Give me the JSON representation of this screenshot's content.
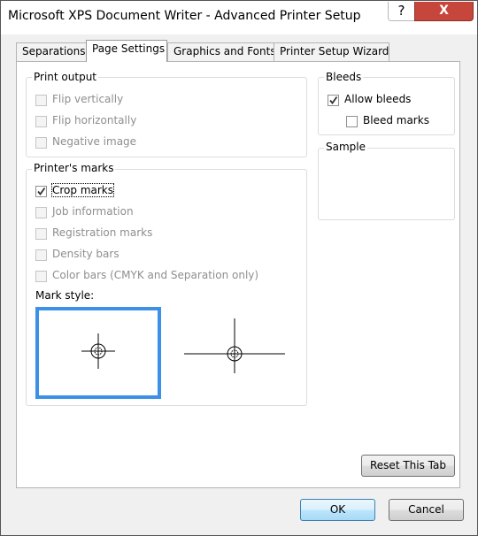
{
  "window": {
    "title": "Microsoft XPS Document Writer - Advanced Printer Setup",
    "help_glyph": "?",
    "close_glyph": "X"
  },
  "tabs": [
    {
      "label": "Separations",
      "active": false
    },
    {
      "label": "Page Settings",
      "active": true
    },
    {
      "label": "Graphics and Fonts",
      "active": false
    },
    {
      "label": "Printer Setup Wizard",
      "active": false
    }
  ],
  "print_output": {
    "title": "Print output",
    "options": [
      {
        "label": "Flip vertically",
        "checked": false,
        "enabled": false
      },
      {
        "label": "Flip horizontally",
        "checked": false,
        "enabled": false
      },
      {
        "label": "Negative image",
        "checked": false,
        "enabled": false
      }
    ]
  },
  "bleeds": {
    "title": "Bleeds",
    "options": [
      {
        "label": "Allow bleeds",
        "checked": true,
        "enabled": true
      },
      {
        "label": "Bleed marks",
        "checked": false,
        "enabled": true
      }
    ]
  },
  "sample": {
    "title": "Sample"
  },
  "printers_marks": {
    "title": "Printer's marks",
    "options": [
      {
        "label": "Crop marks",
        "checked": true,
        "enabled": true
      },
      {
        "label": "Job information",
        "checked": false,
        "enabled": false
      },
      {
        "label": "Registration marks",
        "checked": false,
        "enabled": false
      },
      {
        "label": "Density bars",
        "checked": false,
        "enabled": false
      },
      {
        "label": "Color bars (CMYK and Separation only)",
        "checked": false,
        "enabled": false
      }
    ],
    "mark_style_label": "Mark style:",
    "mark_styles": [
      {
        "name": "short crop marks",
        "selected": true
      },
      {
        "name": "long crop marks",
        "selected": false
      }
    ]
  },
  "buttons": {
    "reset": "Reset This Tab",
    "ok": "OK",
    "cancel": "Cancel"
  }
}
